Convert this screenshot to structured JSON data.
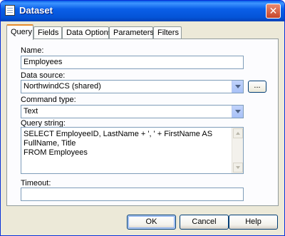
{
  "window": {
    "title": "Dataset",
    "close_symbol": "✕"
  },
  "tabs": [
    {
      "label": "Query",
      "active": true
    },
    {
      "label": "Fields"
    },
    {
      "label": "Data Options"
    },
    {
      "label": "Parameters"
    },
    {
      "label": "Filters"
    }
  ],
  "form": {
    "name_label": "Name:",
    "name_value": "Employees",
    "datasource_label": "Data source:",
    "datasource_value": "NorthwindCS (shared)",
    "browse_label": "...",
    "command_type_label": "Command type:",
    "command_type_value": "Text",
    "query_label": "Query string:",
    "query_line1": "SELECT EmployeeID, LastName + ', ' + FirstName AS FullName, Title",
    "query_line2": "FROM Employees",
    "timeout_label": "Timeout:",
    "timeout_value": ""
  },
  "buttons": {
    "ok": "OK",
    "cancel": "Cancel",
    "help": "Help"
  }
}
